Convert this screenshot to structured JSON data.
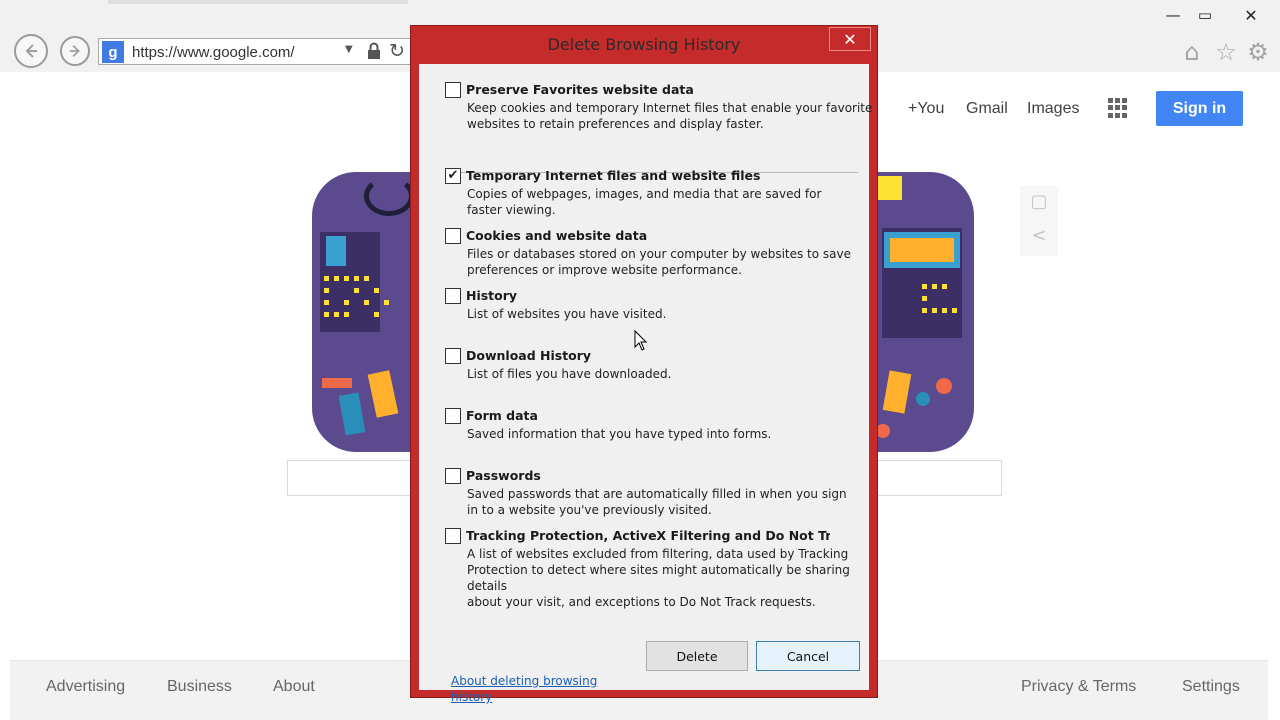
{
  "window": {
    "minimize_glyph": "—",
    "maximize_glyph": "▭",
    "close_glyph": "✕"
  },
  "browser": {
    "back_icon": "back-arrow-icon",
    "forward_icon": "forward-arrow-icon",
    "address": "https://www.google.com/",
    "favicon_letter": "g",
    "dropdown_glyph": "▼",
    "refresh_glyph": "↻",
    "home_glyph": "⌂",
    "star_glyph": "☆",
    "gear_glyph": "⚙"
  },
  "google": {
    "top_links": {
      "you": "+You",
      "gmail": "Gmail",
      "images": "Images"
    },
    "signin_label": "Sign in",
    "side_icons": {
      "collections": "▢",
      "share": "<"
    },
    "footer_left": [
      "Advertising",
      "Business",
      "About"
    ],
    "footer_right": [
      "Privacy & Terms",
      "Settings"
    ]
  },
  "dialog": {
    "title": "Delete Browsing History",
    "close_glyph": "✕",
    "options": [
      {
        "label": "Preserve Favorites website data",
        "checked": false,
        "description_lines": [
          "Keep cookies and temporary Internet files that enable your favorite",
          "websites to retain preferences and display faster."
        ]
      },
      {
        "label": "Temporary Internet files and website files",
        "checked": true,
        "description_lines": [
          "Copies of webpages, images, and media that are saved for",
          "faster viewing."
        ]
      },
      {
        "label": "Cookies and website data",
        "checked": false,
        "description_lines": [
          "Files or databases stored on your computer by websites to save",
          "preferences or improve website performance."
        ]
      },
      {
        "label": "History",
        "checked": false,
        "description_lines": [
          "List of websites you have visited."
        ]
      },
      {
        "label": "Download History",
        "checked": false,
        "description_lines": [
          "List of files you have downloaded."
        ]
      },
      {
        "label": "Form data",
        "checked": false,
        "description_lines": [
          "Saved information that you have typed into forms."
        ]
      },
      {
        "label": "Passwords",
        "checked": false,
        "description_lines": [
          "Saved passwords that are automatically filled in when you sign",
          "in to a website you've previously visited."
        ]
      },
      {
        "label": "Tracking Protection, ActiveX Filtering and Do Not Track d",
        "checked": false,
        "description_lines": [
          "A list of websites excluded from filtering, data used by Tracking",
          "Protection to detect where sites might automatically be sharing details",
          "about your visit, and exceptions to Do Not Track requests."
        ]
      }
    ],
    "about_link_lines": [
      "About deleting browsing",
      "history"
    ],
    "delete_label": "Delete",
    "cancel_label": "Cancel",
    "check_glyph": "✔"
  },
  "colors": {
    "dialog_frame": "#c62b2b",
    "signin_button": "#4285f4",
    "doodle_purple": "#5c4a8e"
  }
}
